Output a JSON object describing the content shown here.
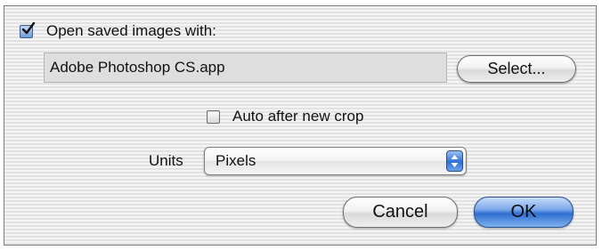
{
  "dialog": {
    "open_with": {
      "checked": true,
      "label": "Open saved images with:"
    },
    "app_path": "Adobe Photoshop CS.app",
    "select_button": "Select...",
    "auto_crop": {
      "checked": false,
      "label": "Auto after new crop"
    },
    "units": {
      "label": "Units",
      "value": "Pixels"
    },
    "cancel_button": "Cancel",
    "ok_button": "OK"
  },
  "colors": {
    "default_button": "#2f6ed1",
    "checkbox_checked": "#6f98d6"
  },
  "icons": {
    "checkmark": "checkmark-icon",
    "popup_arrows": "updown-arrows-icon"
  }
}
